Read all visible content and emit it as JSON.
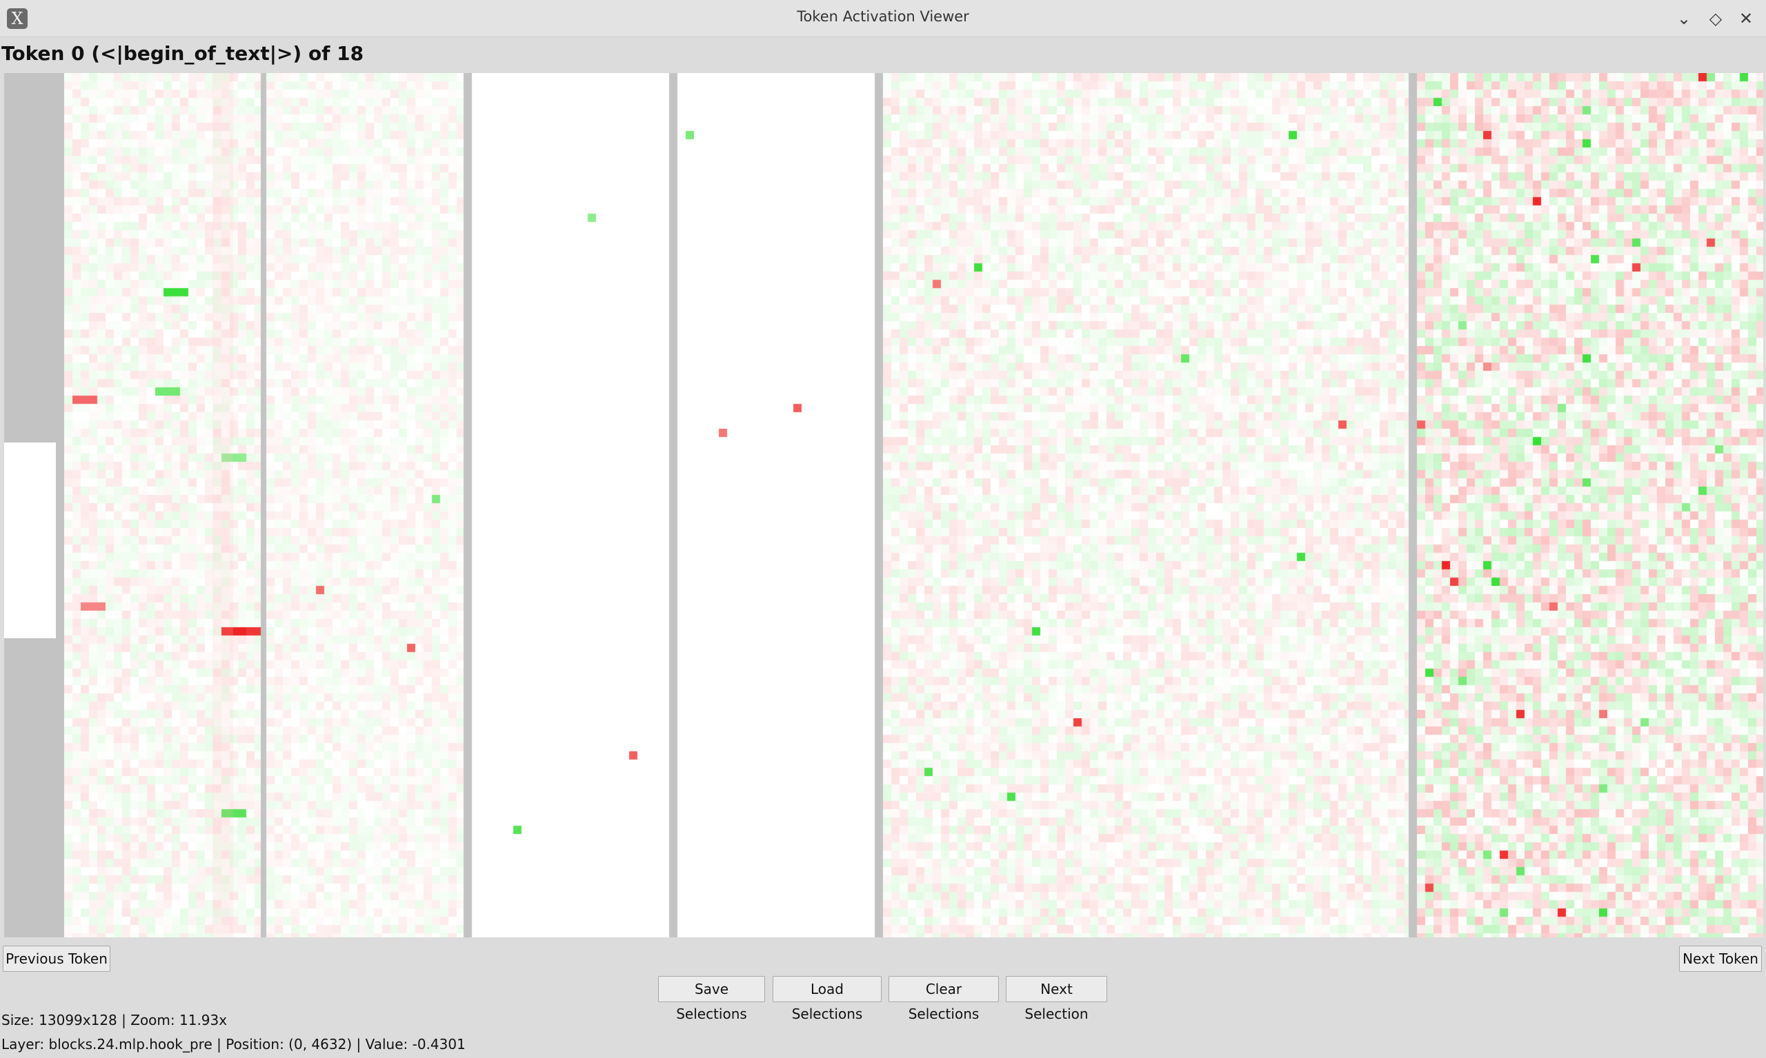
{
  "window": {
    "title": "Token Activation Viewer",
    "app_icon_glyph": "X",
    "controls": [
      "minimize-icon",
      "maximize-icon",
      "close-icon"
    ]
  },
  "heading": "Token 0 (<|begin_of_text|>) of 18",
  "heatmap": {
    "colors": {
      "positive": "#33dd33",
      "negative": "#ee2222",
      "neutral": "#ffffff",
      "separator": "#c3c3c3",
      "scrollbar": "#c3c3c3"
    },
    "panel_count": 6
  },
  "buttons": {
    "previous_token": "Previous Token",
    "next_token": "Next Token",
    "save_selections": "Save Selections",
    "load_selections": "Load Selections",
    "clear_selections": "Clear Selections",
    "next_selection": "Next Selection"
  },
  "status": {
    "size_zoom": "Size: 13099x128 | Zoom: 11.93x",
    "layer_info": "Layer: blocks.24.mlp.hook_pre | Position: (0, 4632) | Value: -0.4301"
  }
}
